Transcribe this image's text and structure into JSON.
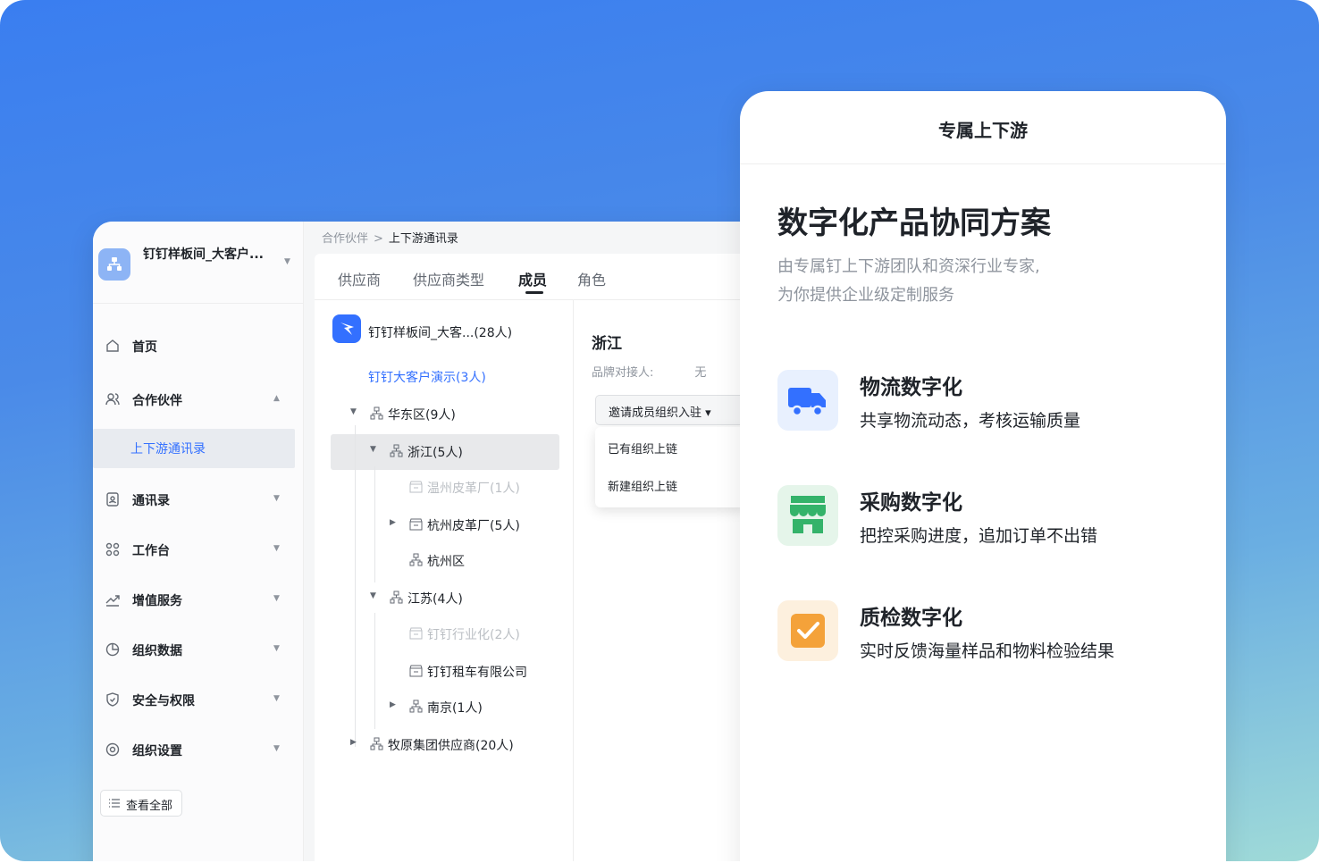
{
  "sidebar": {
    "org_name": "钉钉样板间_大客户...",
    "items": [
      {
        "label": "首页",
        "icon": "home-icon"
      },
      {
        "label": "合作伙伴",
        "icon": "partners-icon"
      },
      {
        "label": "通讯录",
        "icon": "contacts-icon"
      },
      {
        "label": "工作台",
        "icon": "workbench-icon"
      },
      {
        "label": "增值服务",
        "icon": "trend-icon"
      },
      {
        "label": "组织数据",
        "icon": "chart-icon"
      },
      {
        "label": "安全与权限",
        "icon": "shield-icon"
      },
      {
        "label": "组织设置",
        "icon": "settings-icon"
      }
    ],
    "sub_item": "上下游通讯录",
    "view_all": "查看全部"
  },
  "breadcrumb": {
    "parent": "合作伙伴",
    "sep": ">",
    "current": "上下游通讯录"
  },
  "tabs": [
    "供应商",
    "供应商类型",
    "成员",
    "角色"
  ],
  "tree": {
    "root": "钉钉样板间_大客...(28人)",
    "rows": [
      "钉钉大客户演示(3人)",
      "华东区(9人)",
      "浙江(5人)",
      "温州皮革厂(1人)",
      "杭州皮革厂(5人)",
      "杭州区",
      "江苏(4人)",
      "钉钉行业化(2人)",
      "钉钉租车有限公司",
      "南京(1人)",
      "牧原集团供应商(20人)"
    ]
  },
  "detail": {
    "title": "浙江",
    "meta_label": "品牌对接人:",
    "meta_value": "无",
    "invite_label": "邀请成员组织入驻 ▾",
    "dropdown": [
      "已有组织上链",
      "新建组织上链"
    ]
  },
  "card": {
    "header": "专属上下游",
    "title": "数字化产品协同方案",
    "subtitle_1": "由专属钉上下游团队和资深行业专家,",
    "subtitle_2": "为你提供企业级定制服务",
    "features": [
      {
        "title": "物流数字化",
        "desc": "共享物流动态，考核运输质量",
        "icon": "truck-icon",
        "bg": "#e8f0fe",
        "color": "#3370ff"
      },
      {
        "title": "采购数字化",
        "desc": "把控采购进度，追加订单不出错",
        "icon": "store-icon",
        "bg": "#e5f5ea",
        "color": "#34b36a"
      },
      {
        "title": "质检数字化",
        "desc": "实时反馈海量样品和物料检验结果",
        "icon": "checkbox-icon",
        "bg": "#fdf0de",
        "color": "#f4a23a"
      }
    ]
  },
  "colors": {
    "accent": "#3370ff",
    "text": "#1f2329",
    "muted": "#8f959e"
  }
}
